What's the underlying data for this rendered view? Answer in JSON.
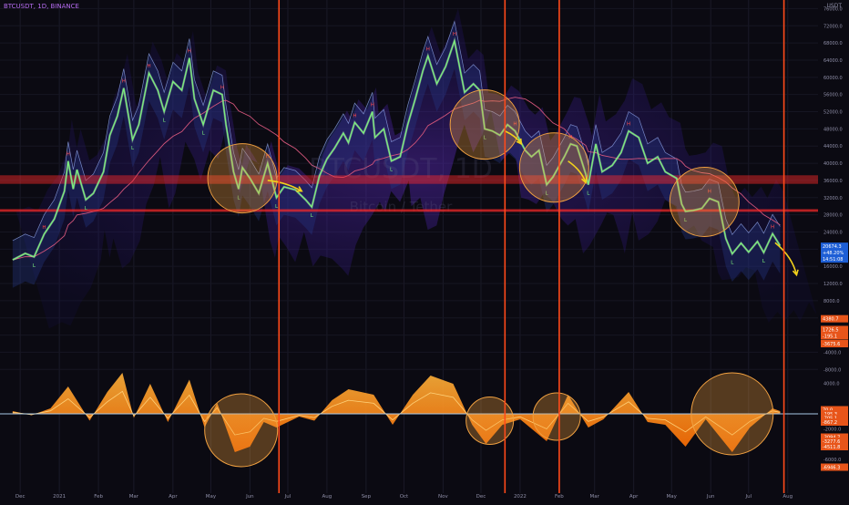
{
  "header": {
    "symbol_line": "BTCUSDT, 1D, BINANCE",
    "currency": "USDT"
  },
  "watermark": {
    "ticker": "BTCUSDT, 1D",
    "name": "Bitcoin / Tether"
  },
  "colors": {
    "background": "#0b0a12",
    "price_line": "#7cf07c",
    "vertical_markers": "#ff4a1a",
    "support_band": "#ff2a2a",
    "annotation_arrow": "#f2d11b",
    "circle_fill": "#f2a23a",
    "oscillator_warm": "#ff8a00",
    "channel": "#3a3aa8"
  },
  "chart_data": {
    "type": "line",
    "title": "",
    "xlabel": "",
    "ylabel": "USDT",
    "x_tick_labels": [
      "Dec",
      "2021",
      "Feb",
      "Mar",
      "Apr",
      "May",
      "Jun",
      "Jul",
      "Aug",
      "Sep",
      "Oct",
      "Nov",
      "Dec",
      "2022",
      "Feb",
      "Mar",
      "Apr",
      "May",
      "Jun",
      "Jul",
      "Aug"
    ],
    "y_ticks": [
      76000,
      72000,
      68000,
      64000,
      60000,
      56000,
      52000,
      48000,
      44000,
      40000,
      36000,
      32000,
      28000,
      24000,
      20000,
      16000,
      12000,
      8000,
      4000,
      0,
      -4000,
      -8000
    ],
    "y_tick_labels": [
      "76000.0",
      "72000.0",
      "68000.0",
      "64000.0",
      "60000.0",
      "56000.0",
      "52000.0",
      "48000.0",
      "44000.0",
      "40000.0",
      "36000.0",
      "32000.0",
      "28000.0",
      "24000.0",
      "20000.0",
      "16000.0",
      "12000.0",
      "8000.0",
      "4000.0",
      "0.0",
      "-4000.0",
      "-8000.0"
    ],
    "ylim": [
      -9000,
      78000
    ],
    "series": [
      {
        "points": [
          [
            "2020-11-25",
            17500
          ],
          [
            "2020-12-05",
            19000
          ],
          [
            "2020-12-12",
            18200
          ],
          [
            "2020-12-20",
            23500
          ],
          [
            "2020-12-28",
            27000
          ],
          [
            "2021-01-05",
            33500
          ],
          [
            "2021-01-08",
            40500
          ],
          [
            "2021-01-12",
            34000
          ],
          [
            "2021-01-15",
            38500
          ],
          [
            "2021-01-22",
            31500
          ],
          [
            "2021-01-28",
            33000
          ],
          [
            "2021-02-05",
            38000
          ],
          [
            "2021-02-10",
            46500
          ],
          [
            "2021-02-16",
            51000
          ],
          [
            "2021-02-21",
            57500
          ],
          [
            "2021-02-28",
            45500
          ],
          [
            "2021-03-05",
            49000
          ],
          [
            "2021-03-13",
            61000
          ],
          [
            "2021-03-20",
            57000
          ],
          [
            "2021-03-25",
            52000
          ],
          [
            "2021-04-01",
            59000
          ],
          [
            "2021-04-08",
            57000
          ],
          [
            "2021-04-14",
            64500
          ],
          [
            "2021-04-18",
            55000
          ],
          [
            "2021-04-25",
            49000
          ],
          [
            "2021-05-03",
            57000
          ],
          [
            "2021-05-10",
            56000
          ],
          [
            "2021-05-13",
            49000
          ],
          [
            "2021-05-19",
            38000
          ],
          [
            "2021-05-23",
            34000
          ],
          [
            "2021-05-26",
            39000
          ],
          [
            "2021-06-01",
            36500
          ],
          [
            "2021-06-08",
            33000
          ],
          [
            "2021-06-15",
            40000
          ],
          [
            "2021-06-22",
            32000
          ],
          [
            "2021-06-28",
            34500
          ],
          [
            "2021-07-07",
            33800
          ],
          [
            "2021-07-15",
            31500
          ],
          [
            "2021-07-20",
            29800
          ],
          [
            "2021-07-26",
            37000
          ],
          [
            "2021-08-01",
            41000
          ],
          [
            "2021-08-07",
            43500
          ],
          [
            "2021-08-14",
            47000
          ],
          [
            "2021-08-18",
            44800
          ],
          [
            "2021-08-23",
            49500
          ],
          [
            "2021-08-30",
            47000
          ],
          [
            "2021-09-06",
            52000
          ],
          [
            "2021-09-08",
            46000
          ],
          [
            "2021-09-15",
            48000
          ],
          [
            "2021-09-21",
            40500
          ],
          [
            "2021-09-28",
            41500
          ],
          [
            "2021-10-04",
            49000
          ],
          [
            "2021-10-10",
            55000
          ],
          [
            "2021-10-16",
            61500
          ],
          [
            "2021-10-20",
            65000
          ],
          [
            "2021-10-27",
            58500
          ],
          [
            "2021-11-03",
            62500
          ],
          [
            "2021-11-10",
            68500
          ],
          [
            "2021-11-18",
            56500
          ],
          [
            "2021-11-25",
            58500
          ],
          [
            "2021-11-30",
            57000
          ],
          [
            "2021-12-04",
            48000
          ],
          [
            "2021-12-10",
            47500
          ],
          [
            "2021-12-16",
            46500
          ],
          [
            "2021-12-22",
            49000
          ],
          [
            "2021-12-28",
            47500
          ],
          [
            "2022-01-05",
            43000
          ],
          [
            "2022-01-10",
            41500
          ],
          [
            "2022-01-16",
            43000
          ],
          [
            "2022-01-22",
            35000
          ],
          [
            "2022-01-27",
            36800
          ],
          [
            "2022-02-05",
            41500
          ],
          [
            "2022-02-10",
            44500
          ],
          [
            "2022-02-15",
            44000
          ],
          [
            "2022-02-22",
            37500
          ],
          [
            "2022-02-24",
            35000
          ],
          [
            "2022-03-02",
            44500
          ],
          [
            "2022-03-07",
            38000
          ],
          [
            "2022-03-15",
            39500
          ],
          [
            "2022-03-22",
            42500
          ],
          [
            "2022-03-28",
            47500
          ],
          [
            "2022-04-05",
            46000
          ],
          [
            "2022-04-12",
            40000
          ],
          [
            "2022-04-20",
            41500
          ],
          [
            "2022-04-26",
            38000
          ],
          [
            "2022-05-05",
            36500
          ],
          [
            "2022-05-09",
            30500
          ],
          [
            "2022-05-12",
            28800
          ],
          [
            "2022-05-18",
            29000
          ],
          [
            "2022-05-25",
            29500
          ],
          [
            "2022-05-31",
            31800
          ],
          [
            "2022-06-07",
            31000
          ],
          [
            "2022-06-13",
            22500
          ],
          [
            "2022-06-18",
            18900
          ],
          [
            "2022-06-25",
            21400
          ],
          [
            "2022-07-01",
            19300
          ],
          [
            "2022-07-08",
            21800
          ],
          [
            "2022-07-13",
            19200
          ],
          [
            "2022-07-20",
            23600
          ],
          [
            "2022-07-26",
            20800
          ]
        ]
      }
    ],
    "date_range": [
      "2020-11-15",
      "2022-08-25"
    ],
    "vertical_markers": [
      "2021-06-24",
      "2021-12-20",
      "2022-02-01",
      "2022-07-29"
    ],
    "horizontal_bands": [
      {
        "from": 35200,
        "to": 37200
      },
      {
        "from": 28700,
        "to": 29300
      }
    ],
    "pivots_high": [
      [
        "2020-12-20",
        23500,
        "H"
      ],
      [
        "2021-01-08",
        40500,
        "H"
      ],
      [
        "2021-02-21",
        57500,
        "H"
      ],
      [
        "2021-03-13",
        61000,
        "H"
      ],
      [
        "2021-04-14",
        64500,
        "H"
      ],
      [
        "2021-05-10",
        56000,
        "H"
      ],
      [
        "2021-06-15",
        40000,
        "H"
      ],
      [
        "2021-08-23",
        49500,
        "H"
      ],
      [
        "2021-09-06",
        52000,
        "H"
      ],
      [
        "2021-10-20",
        65000,
        "H"
      ],
      [
        "2021-11-10",
        68500,
        "H"
      ],
      [
        "2021-12-28",
        47500,
        "H"
      ],
      [
        "2022-02-10",
        44500,
        "H"
      ],
      [
        "2022-03-28",
        47500,
        "H"
      ],
      [
        "2022-05-31",
        31800,
        "H"
      ],
      [
        "2022-07-20",
        23600,
        "H"
      ]
    ],
    "pivots_low": [
      [
        "2020-12-12",
        18200,
        "L"
      ],
      [
        "2021-01-22",
        31500,
        "L"
      ],
      [
        "2021-02-28",
        45500,
        "L"
      ],
      [
        "2021-03-25",
        52000,
        "L"
      ],
      [
        "2021-04-25",
        49000,
        "L"
      ],
      [
        "2021-05-23",
        34000,
        "L"
      ],
      [
        "2021-06-22",
        32000,
        "L"
      ],
      [
        "2021-07-20",
        29800,
        "L"
      ],
      [
        "2021-09-21",
        40500,
        "L"
      ],
      [
        "2021-12-04",
        48000,
        "L"
      ],
      [
        "2022-01-22",
        35000,
        "L"
      ],
      [
        "2022-02-24",
        35000,
        "L"
      ],
      [
        "2022-05-12",
        28800,
        "L"
      ],
      [
        "2022-06-18",
        18900,
        "L"
      ],
      [
        "2022-07-13",
        19200,
        "L"
      ]
    ],
    "price_circles": [
      [
        "2021-05-26",
        36500
      ],
      [
        "2021-12-04",
        49000
      ],
      [
        "2022-01-28",
        39000
      ],
      [
        "2022-05-27",
        31000
      ]
    ],
    "price_arrows": [
      [
        [
          "2021-06-15",
          36000
        ],
        [
          "2021-07-12",
          33500
        ]
      ],
      [
        [
          "2021-12-20",
          47500
        ],
        [
          "2022-01-02",
          44500
        ]
      ],
      [
        [
          "2022-02-08",
          40500
        ],
        [
          "2022-02-22",
          35500
        ]
      ],
      [
        [
          "2022-07-22",
          21500
        ],
        [
          "2022-08-08",
          14000
        ]
      ]
    ],
    "oscillator": {
      "circles": [
        [
          "2021-05-25",
          -12
        ],
        [
          "2021-12-08",
          -5
        ],
        [
          "2022-01-30",
          -2
        ],
        [
          "2022-06-18",
          0
        ]
      ],
      "points": [
        [
          "2020-11-25",
          2
        ],
        [
          "2020-12-10",
          -1
        ],
        [
          "2020-12-25",
          4
        ],
        [
          "2021-01-08",
          20
        ],
        [
          "2021-01-25",
          -5
        ],
        [
          "2021-02-08",
          16
        ],
        [
          "2021-02-20",
          30
        ],
        [
          "2021-03-01",
          -3
        ],
        [
          "2021-03-14",
          22
        ],
        [
          "2021-03-28",
          -6
        ],
        [
          "2021-04-14",
          25
        ],
        [
          "2021-04-26",
          -10
        ],
        [
          "2021-05-06",
          8
        ],
        [
          "2021-05-20",
          -28
        ],
        [
          "2021-06-01",
          -24
        ],
        [
          "2021-06-12",
          -6
        ],
        [
          "2021-06-22",
          -10
        ],
        [
          "2021-07-10",
          -2
        ],
        [
          "2021-07-22",
          -5
        ],
        [
          "2021-08-05",
          10
        ],
        [
          "2021-08-18",
          18
        ],
        [
          "2021-09-07",
          14
        ],
        [
          "2021-09-22",
          -8
        ],
        [
          "2021-10-08",
          14
        ],
        [
          "2021-10-22",
          28
        ],
        [
          "2021-11-09",
          22
        ],
        [
          "2021-11-24",
          -8
        ],
        [
          "2021-12-05",
          -22
        ],
        [
          "2021-12-18",
          -8
        ],
        [
          "2022-01-01",
          -4
        ],
        [
          "2022-01-22",
          -20
        ],
        [
          "2022-02-08",
          14
        ],
        [
          "2022-02-24",
          -10
        ],
        [
          "2022-03-08",
          -4
        ],
        [
          "2022-03-28",
          16
        ],
        [
          "2022-04-12",
          -6
        ],
        [
          "2022-04-26",
          -8
        ],
        [
          "2022-05-12",
          -24
        ],
        [
          "2022-05-28",
          -4
        ],
        [
          "2022-06-18",
          -28
        ],
        [
          "2022-07-02",
          -10
        ],
        [
          "2022-07-20",
          4
        ],
        [
          "2022-07-26",
          2
        ]
      ],
      "y_ticks": [
        4000,
        0,
        -2000,
        -4000,
        -6000
      ],
      "y_tick_labels": [
        "4000.0",
        "0.0",
        "-2000.0",
        "-4000.0",
        "-6000.0"
      ]
    },
    "price_markers": [
      {
        "label": "20674.3",
        "value": 20674,
        "bg": "#1e5fd6"
      },
      {
        "label": "+48.20%",
        "value": 19200,
        "bg": "#1e5fd6"
      },
      {
        "label": "14:51:08",
        "value": 17700,
        "bg": "#1e5fd6"
      },
      {
        "label": "4380.7",
        "value": 3800,
        "bg": "#e8551a"
      },
      {
        "label": "1726.5",
        "value": 1300,
        "bg": "#e8551a"
      },
      {
        "label": "-195.1",
        "value": -200,
        "bg": "#e8551a"
      },
      {
        "label": "-3675.6",
        "value": -2000,
        "bg": "#e8551a"
      }
    ],
    "oscillator_markers": [
      {
        "label": "70.0",
        "osc": 3,
        "bg": "#e8551a"
      },
      {
        "label": "-195.3",
        "osc": 0,
        "bg": "#e8551a"
      },
      {
        "label": "-705.1",
        "osc": -3,
        "bg": "#e8551a"
      },
      {
        "label": "-867.2",
        "osc": -6,
        "bg": "#e8551a"
      },
      {
        "label": "-3094.7",
        "osc": -17,
        "bg": "#e8551a"
      },
      {
        "label": "-3277.6",
        "osc": -20,
        "bg": "#e8551a"
      },
      {
        "label": "-4511.8",
        "osc": -24,
        "bg": "#e8551a"
      },
      {
        "label": "-6946.3",
        "osc": -39,
        "bg": "#e8551a"
      }
    ]
  }
}
